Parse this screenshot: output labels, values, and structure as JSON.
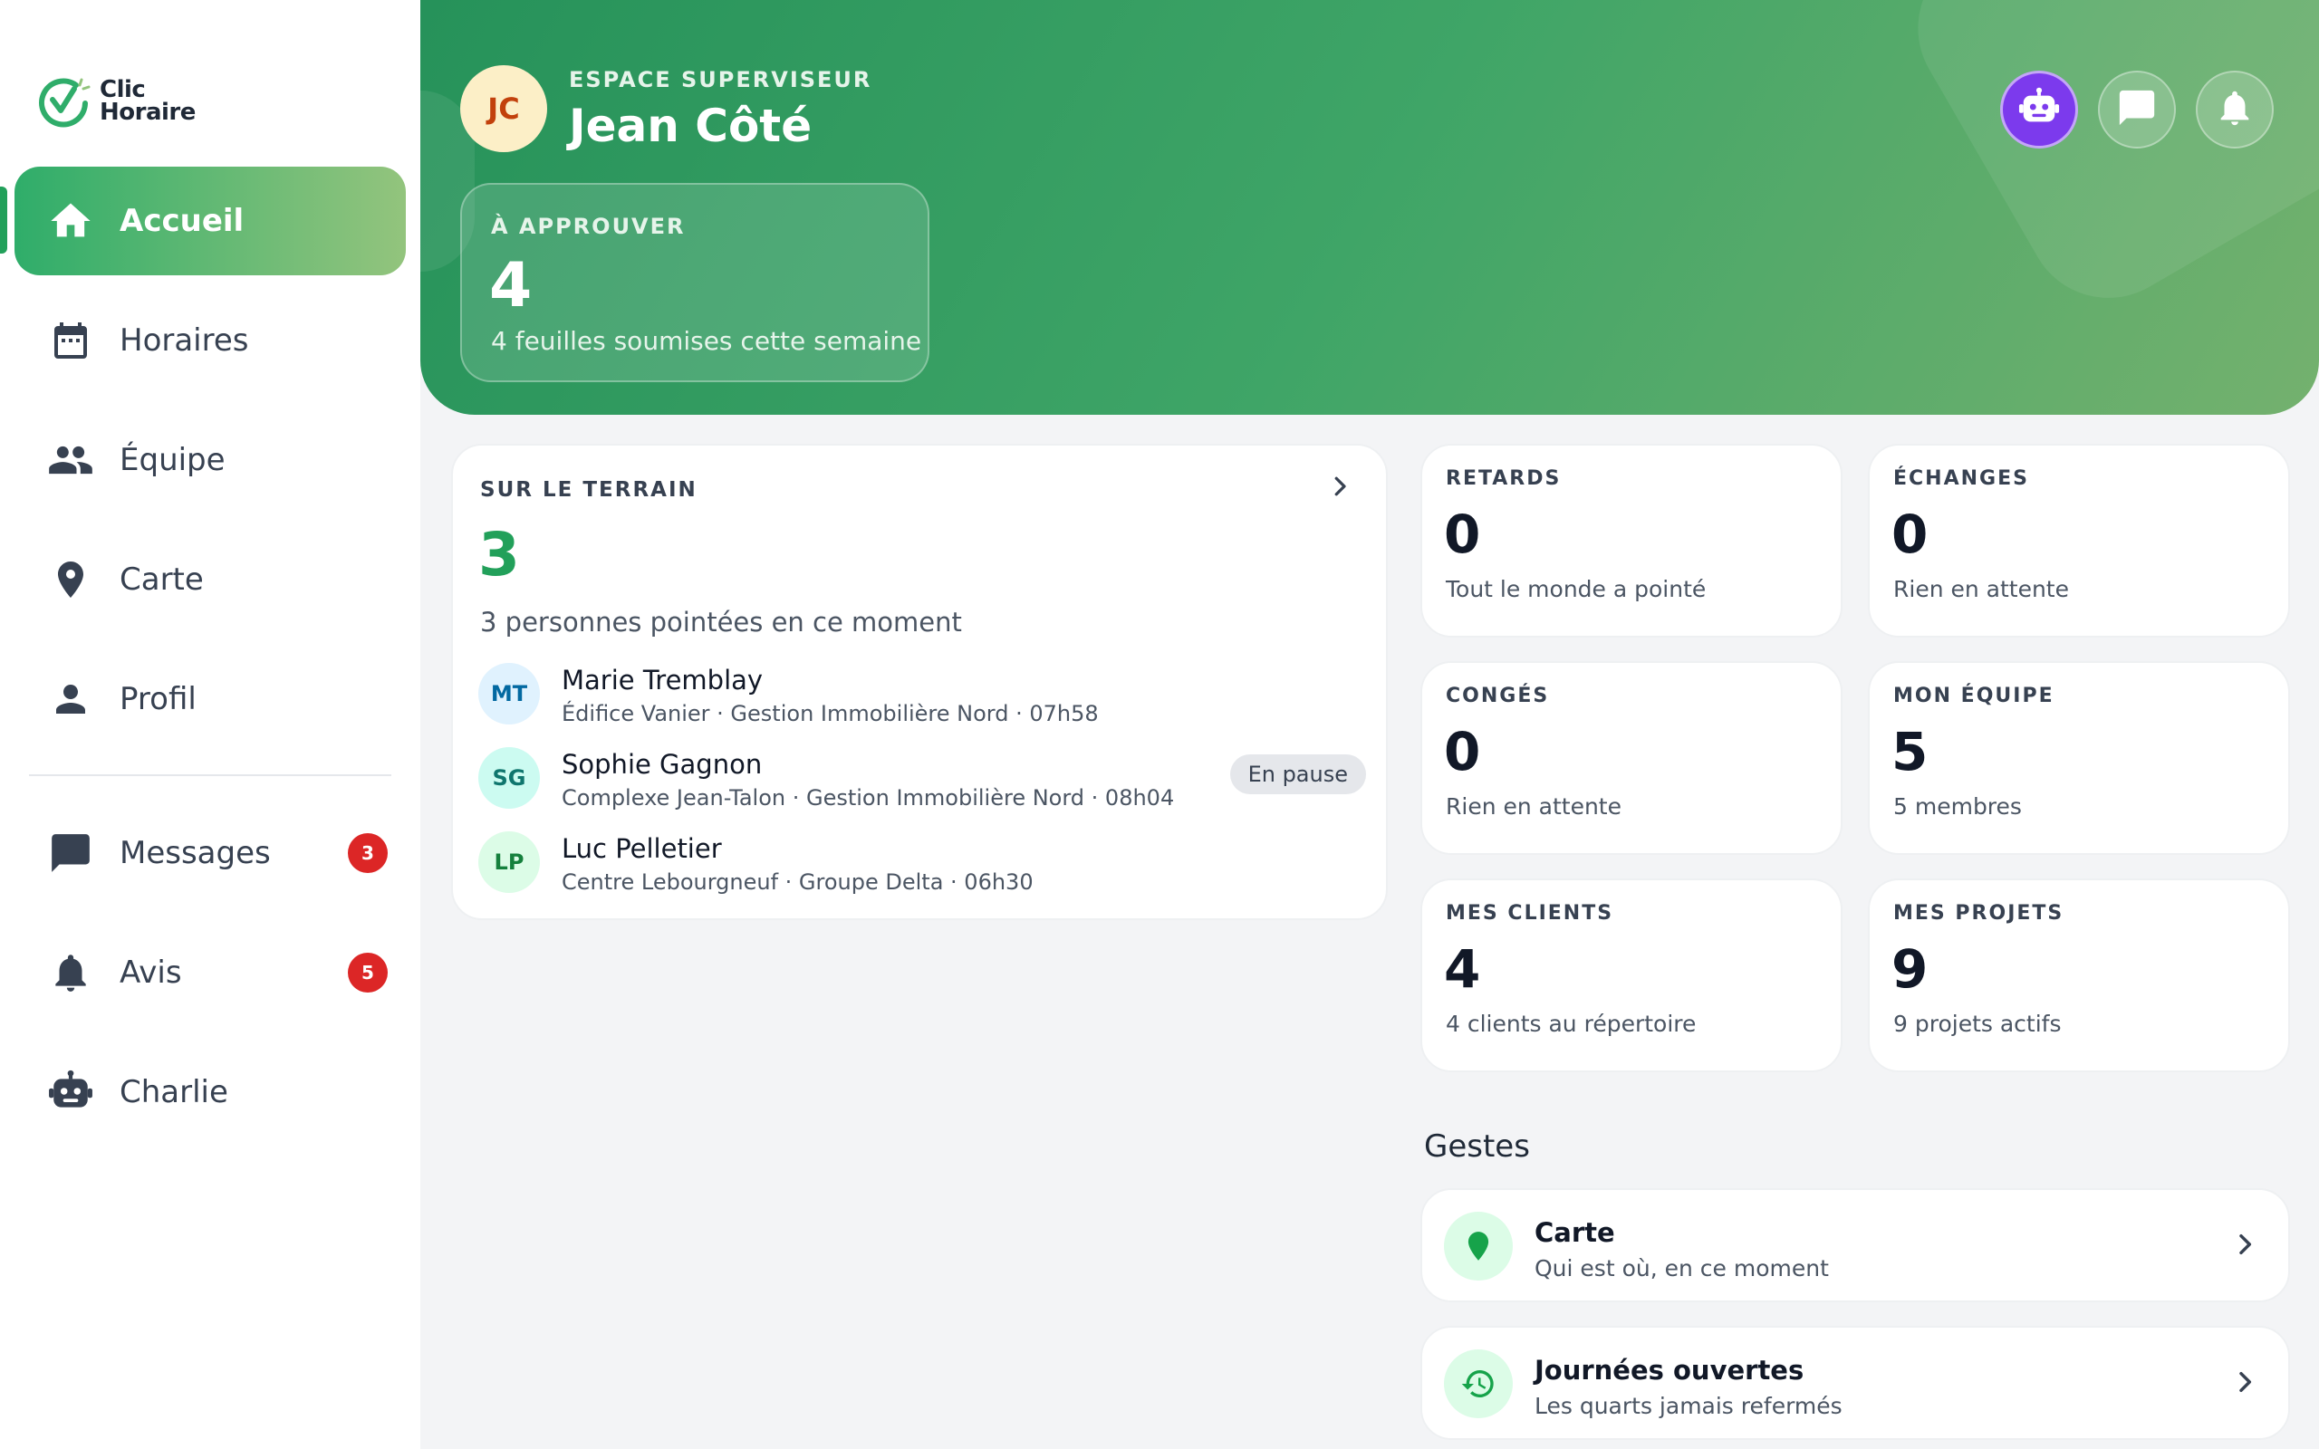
{
  "brand": {
    "line1": "Clic",
    "line2": "Horaire"
  },
  "nav": {
    "items": [
      {
        "label": "Accueil",
        "icon": "home-icon"
      },
      {
        "label": "Horaires",
        "icon": "calendar-icon"
      },
      {
        "label": "Équipe",
        "icon": "team-icon"
      },
      {
        "label": "Carte",
        "icon": "map-pin-icon"
      },
      {
        "label": "Profil",
        "icon": "person-icon"
      },
      {
        "label": "Messages",
        "icon": "chat-icon",
        "badge": "3"
      },
      {
        "label": "Avis",
        "icon": "bell-icon",
        "badge": "5"
      },
      {
        "label": "Charlie",
        "icon": "robot-icon"
      }
    ]
  },
  "hero": {
    "initials": "JC",
    "kicker": "ESPACE SUPERVISEUR",
    "name": "Jean Côté",
    "approve": {
      "label": "À APPROUVER",
      "value": "4",
      "sub": "4 feuilles soumises cette semaine"
    }
  },
  "terrain": {
    "title": "SUR LE TERRAIN",
    "count": "3",
    "sub": "3 personnes pointées en ce moment",
    "people": [
      {
        "initials": "MT",
        "name": "Marie Tremblay",
        "detail": "Édifice Vanier · Gestion Immobilière Nord · 07h58",
        "status": ""
      },
      {
        "initials": "SG",
        "name": "Sophie Gagnon",
        "detail": "Complexe Jean-Talon · Gestion Immobilière Nord · 08h04",
        "status": "En pause"
      },
      {
        "initials": "LP",
        "name": "Luc Pelletier",
        "detail": "Centre Lebourgneuf · Groupe Delta · 06h30",
        "status": ""
      }
    ]
  },
  "stats": {
    "retards": {
      "label": "RETARDS",
      "value": "0",
      "sub": "Tout le monde a pointé"
    },
    "echanges": {
      "label": "ÉCHANGES",
      "value": "0",
      "sub": "Rien en attente"
    },
    "conges": {
      "label": "CONGÉS",
      "value": "0",
      "sub": "Rien en attente"
    },
    "equipe": {
      "label": "MON ÉQUIPE",
      "value": "5",
      "sub": "5 membres"
    },
    "clients": {
      "label": "MES CLIENTS",
      "value": "4",
      "sub": "4 clients au répertoire"
    },
    "projets": {
      "label": "MES PROJETS",
      "value": "9",
      "sub": "9 projets actifs"
    }
  },
  "gestes": {
    "title": "Gestes",
    "actions": [
      {
        "title": "Carte",
        "desc": "Qui est où, en ce moment",
        "icon": "map-pin-icon"
      },
      {
        "title": "Journées ouvertes",
        "desc": "Les quarts jamais refermés",
        "icon": "history-icon"
      }
    ]
  },
  "colors": {
    "primary": "#22a05a",
    "accent": "#7c3aed",
    "badge": "#dc2626"
  }
}
